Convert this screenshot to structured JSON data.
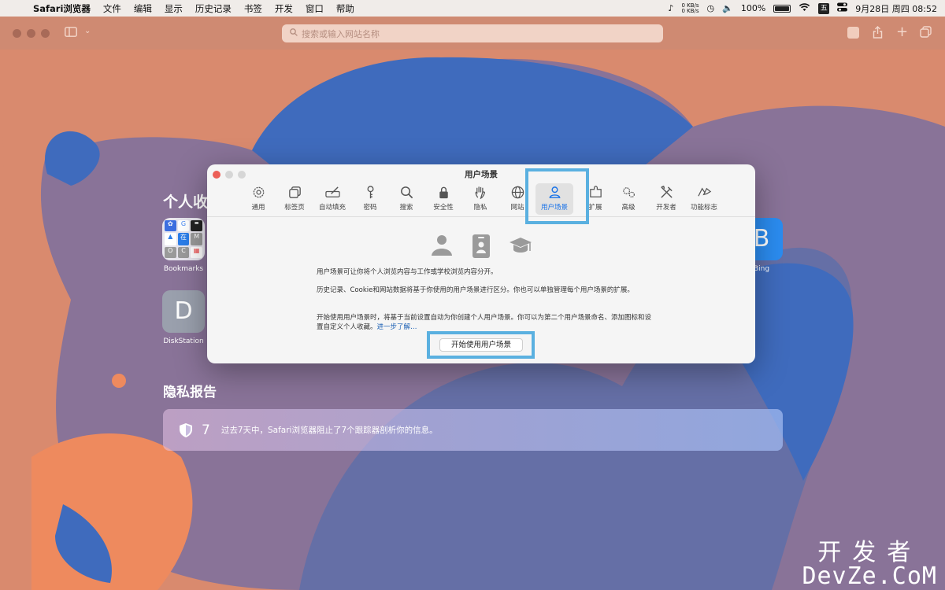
{
  "menubar": {
    "app": "Safari浏览器",
    "items": [
      "文件",
      "编辑",
      "显示",
      "历史记录",
      "书签",
      "开发",
      "窗口",
      "帮助"
    ],
    "net_up": "0 KB/s",
    "net_down": "0 KB/s",
    "battery": "100%",
    "ime": "五",
    "datetime": "9月28日 周四  08:52"
  },
  "toolbar": {
    "address_placeholder": "搜索或输入网站名称"
  },
  "start_page": {
    "favorites_title": "个人收",
    "favorites": [
      {
        "label": "Bookmarks"
      },
      {
        "label": "DiskStation",
        "letter": "D"
      },
      {
        "label": "Bing",
        "letter": "B"
      }
    ],
    "bookmarks_grid": [
      "✿",
      "G",
      "▬",
      "▲",
      "在",
      "M",
      "O",
      "C",
      "▦"
    ],
    "privacy_title": "隐私报告",
    "privacy_count": "7",
    "privacy_message": "过去7天中，Safari浏览器阻止了7个跟踪器剖析你的信息。"
  },
  "dialog": {
    "title": "用户场景",
    "tabs": [
      {
        "label": "通用",
        "icon": "gear-icon"
      },
      {
        "label": "标签页",
        "icon": "tabs-icon"
      },
      {
        "label": "自动填充",
        "icon": "autofill-pen-icon"
      },
      {
        "label": "密码",
        "icon": "key-icon"
      },
      {
        "label": "搜索",
        "icon": "search-icon"
      },
      {
        "label": "安全性",
        "icon": "lock-icon"
      },
      {
        "label": "隐私",
        "icon": "hand-icon"
      },
      {
        "label": "网站",
        "icon": "globe-icon"
      },
      {
        "label": "用户场景",
        "icon": "person-icon"
      },
      {
        "label": "扩展",
        "icon": "puzzle-icon"
      },
      {
        "label": "高级",
        "icon": "gears-icon"
      },
      {
        "label": "开发者",
        "icon": "tools-icon"
      },
      {
        "label": "功能标志",
        "icon": "flags-icon"
      }
    ],
    "active_tab": "用户场景",
    "para1": "用户场景可让你将个人浏览内容与工作或学校浏览内容分开。",
    "para2": "历史记录、Cookie和网站数据将基于你使用的用户场景进行区分。你也可以单独管理每个用户场景的扩展。",
    "para3": "开始使用用户场景时，将基于当前设置自动为你创建个人用户场景。你可以为第二个用户场景命名、添加图标和设置自定义个人收藏。",
    "learn_more": "进一步了解…",
    "start_button": "开始使用用户场景"
  },
  "watermark": {
    "line1": "开发者",
    "line2": "DevZe.CoM"
  },
  "colors": {
    "background": "#d98a6e",
    "blue_shape": "#3f6bbd",
    "purple_shape": "#7a6fa0",
    "highlight": "#5ab0e0",
    "accent": "#1a73e8"
  }
}
